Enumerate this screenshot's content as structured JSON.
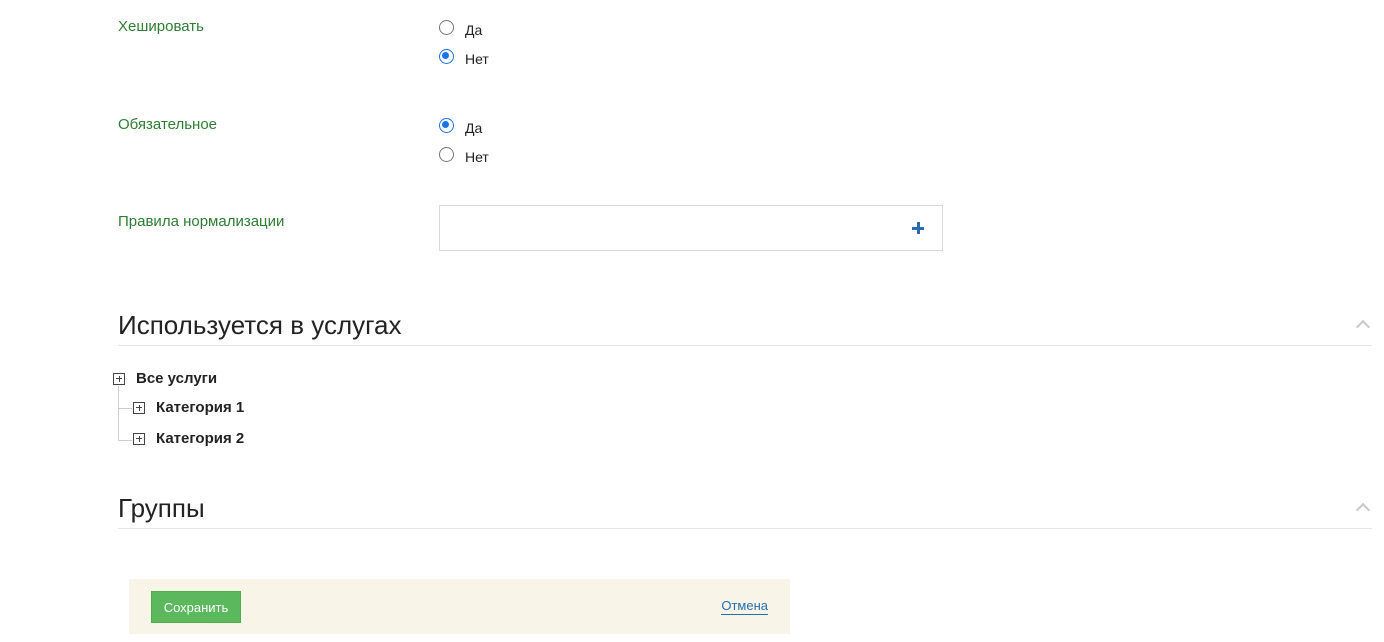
{
  "form": {
    "hash": {
      "label": "Хешировать",
      "options": [
        {
          "label": "Да",
          "checked": false
        },
        {
          "label": "Нет",
          "checked": true
        }
      ]
    },
    "required": {
      "label": "Обязательное",
      "options": [
        {
          "label": "Да",
          "checked": true
        },
        {
          "label": "Нет",
          "checked": false
        }
      ]
    },
    "normalization": {
      "label": "Правила нормализации",
      "add_icon": "plus-icon"
    }
  },
  "services_section": {
    "title": "Используется в услугах",
    "collapse_icon": "chevron-up-icon",
    "tree": {
      "root": "Все услуги",
      "children": [
        "Категория 1",
        "Категория 2"
      ]
    }
  },
  "groups_section": {
    "title": "Группы",
    "collapse_icon": "chevron-up-icon"
  },
  "actions": {
    "save_label": "Сохранить",
    "cancel_label": "Отмена"
  },
  "colors": {
    "label_green": "#2e7d32",
    "accent_blue": "#1a73e8",
    "save_green": "#5cb85c",
    "action_bar_bg": "#f8f4e8"
  }
}
